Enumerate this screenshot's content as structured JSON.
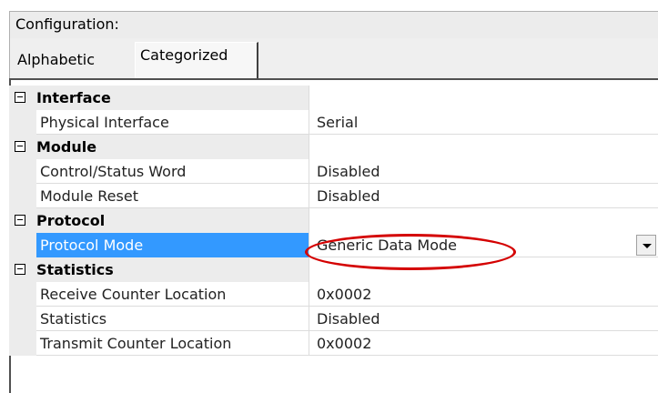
{
  "header": {
    "title": "Configuration:"
  },
  "tabs": [
    {
      "label": "Alphabetic"
    },
    {
      "label": "Categorized"
    }
  ],
  "categories": [
    {
      "label": "Interface",
      "properties": [
        {
          "name": "Physical Interface",
          "value": "Serial"
        }
      ]
    },
    {
      "label": "Module",
      "properties": [
        {
          "name": "Control/Status Word",
          "value": "Disabled"
        },
        {
          "name": "Module Reset",
          "value": "Disabled"
        }
      ]
    },
    {
      "label": "Protocol",
      "properties": [
        {
          "name": "Protocol Mode",
          "value": "Generic Data Mode",
          "selected": true
        }
      ]
    },
    {
      "label": "Statistics",
      "properties": [
        {
          "name": "Receive Counter Location",
          "value": "0x0002"
        },
        {
          "name": "Statistics",
          "value": "Disabled"
        },
        {
          "name": "Transmit Counter Location",
          "value": "0x0002"
        }
      ]
    }
  ],
  "highlight": {
    "color": "#d40000"
  }
}
